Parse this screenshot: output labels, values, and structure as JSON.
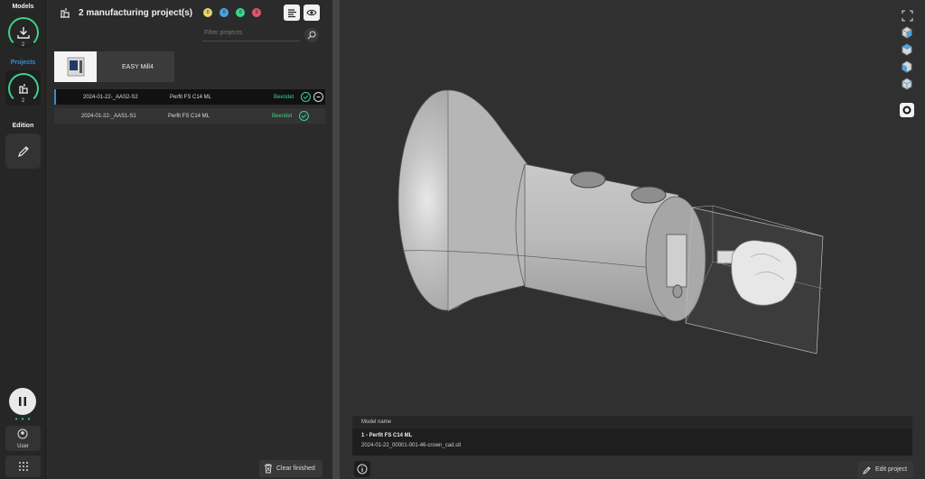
{
  "rail": {
    "models_label": "Models",
    "models_count": "2",
    "projects_label": "Projects",
    "projects_count": "2",
    "edition_label": "Edition",
    "user_label": "User"
  },
  "panel": {
    "title": "2 manufacturing project(s)",
    "status_dots": [
      {
        "count": "0",
        "color": "#e8d36a"
      },
      {
        "count": "0",
        "color": "#4aa3df"
      },
      {
        "count": "0",
        "color": "#3dd28a"
      },
      {
        "count": "0",
        "color": "#e0566c"
      }
    ],
    "filter_placeholder": "Filter projects",
    "machine_name": "EASY Mill4",
    "projects": [
      {
        "name": "2024-01-22-_AAS2-S2",
        "material": "Perfit FS C14 ML",
        "status": "Beendet"
      },
      {
        "name": "2024-01-22-_AAS1-S1",
        "material": "Perfit FS C14 ML",
        "status": "Beendet"
      }
    ],
    "clear_label": "Clear finished"
  },
  "viewport": {
    "model_card_header": "Model name",
    "model_name": "1 - Perfit FS C14 ML",
    "model_file": "2024-01-22_00001-001-46-crown_cad.stl",
    "edit_label": "Edit project"
  },
  "colors": {
    "accent_green": "#3dd28a",
    "accent_blue": "#2f8fd8"
  }
}
